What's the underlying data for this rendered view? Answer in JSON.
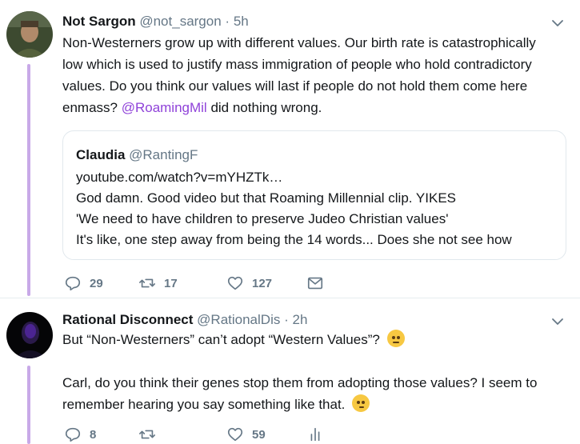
{
  "tweet1": {
    "display_name": "Not Sargon",
    "handle": "@not_sargon",
    "separator": "·",
    "time": "5h",
    "text_lines": [
      "Non-Westerners grow up with different values. Our birth rate is catastrophically",
      "low which is used to justify mass immigration of people who hold contradictory",
      "values. Do you think our values will last if people do not hold them come here"
    ],
    "text_last_prefix": "enmass? ",
    "mention": "@RoamingMil",
    "text_last_suffix": " did nothing wrong.",
    "quote": {
      "display_name": "Claudia",
      "handle": "@RantingF",
      "lines": [
        "youtube.com/watch?v=mYHZTk…",
        "God damn. Good video but that Roaming Millennial clip. YIKES",
        "'We need to have children to preserve Judeo Christian values'",
        "It's like, one step away from being the 14 words... Does she not see how"
      ]
    },
    "actions": {
      "replies": "29",
      "retweets": "17",
      "likes": "127"
    }
  },
  "tweet2": {
    "display_name": "Rational Disconnect",
    "handle": "@RationalDis",
    "separator": "·",
    "time": "2h",
    "line1": "But “Non-Westerners” can’t adopt “Western Values”?",
    "line2": "Carl, do you think their genes stop them from adopting those values? I seem to",
    "line3": "remember hearing you say something like that.",
    "emoji1": "face-with-raised-eyebrow",
    "emoji2": "thinking-face",
    "actions": {
      "replies": "8",
      "retweets": "",
      "likes": "59"
    }
  },
  "colors": {
    "thread_line": "#c8a9e8",
    "mention": "#8f42d9",
    "secondary_text": "#657786"
  }
}
